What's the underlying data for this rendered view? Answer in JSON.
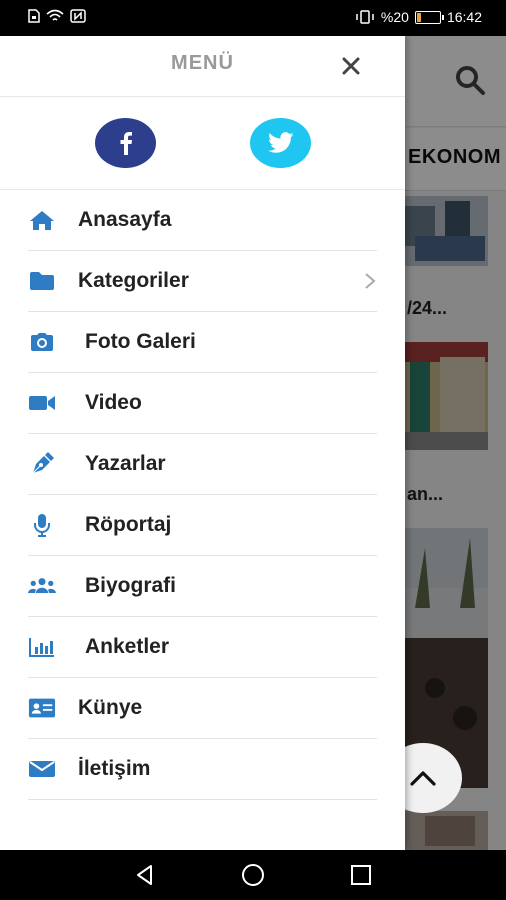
{
  "status_bar": {
    "battery_text": "%20",
    "time": "16:42",
    "battery_level": 0.2,
    "left_icons": [
      "sim-icon",
      "wifi-icon",
      "nfc-icon"
    ],
    "right_icons": [
      "vibrate-icon",
      "battery-icon"
    ]
  },
  "background": {
    "tab_text": "EKONOM",
    "snippet_1": "/24...",
    "snippet_2": "an..."
  },
  "drawer": {
    "title": "MENÜ",
    "social": {
      "facebook_color": "#2c3e8c",
      "twitter_color": "#1fc6f0"
    },
    "items": [
      {
        "label": "Anasayfa",
        "icon": "home-icon"
      },
      {
        "label": "Kategoriler",
        "icon": "folder-icon"
      },
      {
        "label": "Foto Galeri",
        "icon": "camera-icon"
      },
      {
        "label": "Video",
        "icon": "video-icon"
      },
      {
        "label": "Yazarlar",
        "icon": "pen-icon"
      },
      {
        "label": "Röportaj",
        "icon": "microphone-icon"
      },
      {
        "label": "Biyografi",
        "icon": "users-icon"
      },
      {
        "label": "Anketler",
        "icon": "bar-chart-icon"
      },
      {
        "label": "Künye",
        "icon": "id-card-icon"
      },
      {
        "label": "İletişim",
        "icon": "envelope-icon"
      }
    ]
  },
  "colors": {
    "icon_blue": "#2e7dc4"
  }
}
